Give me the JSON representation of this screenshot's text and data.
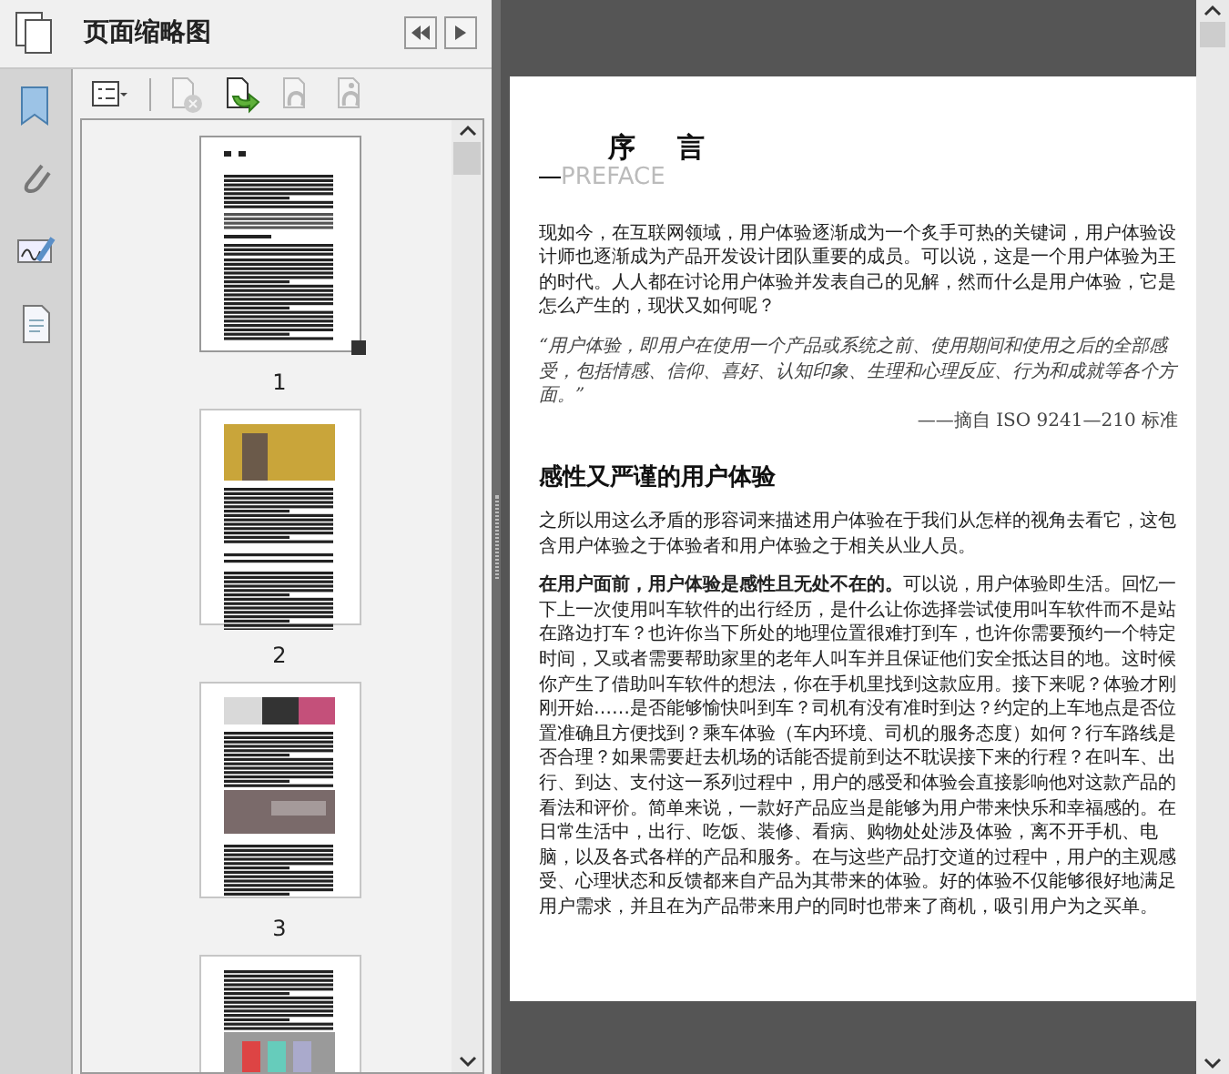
{
  "sidebar": {
    "title": "页面缩略图",
    "toolbar": [
      {
        "kind": "options",
        "disabled": false
      },
      {
        "kind": "delete",
        "disabled": true
      },
      {
        "kind": "insert",
        "disabled": false
      },
      {
        "kind": "undo",
        "disabled": true
      },
      {
        "kind": "redo",
        "disabled": true
      }
    ],
    "thumbnails": [
      {
        "label": "1",
        "kind": "text",
        "selected": true
      },
      {
        "label": "2",
        "kind": "photo-top",
        "selected": false
      },
      {
        "label": "3",
        "kind": "photos",
        "selected": false
      },
      {
        "kind": "text-photo",
        "selected": false
      }
    ]
  },
  "document": {
    "title": "序　言",
    "subtitle": "PREFACE",
    "blocks": [
      {
        "kind": "paragraph",
        "text": "现如今，在互联网领域，用户体验逐渐成为一个炙手可热的关键词，用户体验设计师也逐渐成为产品开发设计团队重要的成员。可以说，这是一个用户体验为王的时代。人人都在讨论用户体验并发表自己的见解，然而什么是用户体验，它是怎么产生的，现状又如何呢？"
      },
      {
        "kind": "quote",
        "text": "“用户体验，即用户在使用一个产品或系统之前、使用期间和使用之后的全部感受，包括情感、信仰、喜好、认知印象、生理和心理反应、行为和成就等各个方面。”"
      },
      {
        "kind": "attribution",
        "text": "——摘自 ISO 9241—210 标准"
      },
      {
        "kind": "heading",
        "text": "感性又严谨的用户体验"
      },
      {
        "kind": "paragraph",
        "text": "之所以用这么矛盾的形容词来描述用户体验在于我们从怎样的视角去看它，这包含用户体验之于体验者和用户体验之于相关从业人员。"
      },
      {
        "kind": "paragraph",
        "text": "**在用户面前，用户体验是感性且无处不在的。**可以说，用户体验即生活。回忆一下上一次使用叫车软件的出行经历，是什么让你选择尝试使用叫车软件而不是站在路边打车？也许你当下所处的地理位置很难打到车，也许你需要预约一个特定时间，又或者需要帮助家里的老年人叫车并且保证他们安全抵达目的地。这时候你产生了借助叫车软件的想法，你在手机里找到这款应用。接下来呢？体验才刚刚开始……是否能够愉快叫到车？司机有没有准时到达？约定的上车地点是否位置准确且方便找到？乘车体验（车内环境、司机的服务态度）如何？行车路线是否合理？如果需要赶去机场的话能否提前到达不耽误接下来的行程？在叫车、出行、到达、支付这一系列过程中，用户的感受和体验会直接影响他对这款产品的看法和评价。简单来说，一款好产品应当是能够为用户带来快乐和幸福感的。在日常生活中，出行、吃饭、装修、看病、购物处处涉及体验，离不开手机、电脑，以及各式各样的产品和服务。在与这些产品打交道的过程中，用户的主观感受、心理状态和反馈都来自产品为其带来的体验。好的体验不仅能够很好地满足用户需求，并且在为产品带来用户的同时也带来了商机，吸引用户为之买单。"
      }
    ]
  }
}
